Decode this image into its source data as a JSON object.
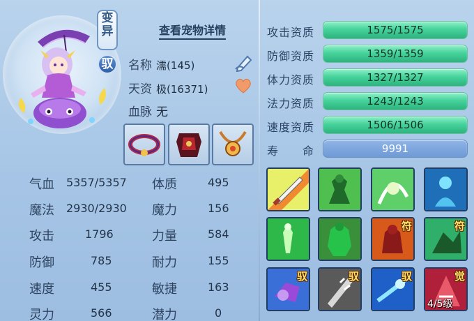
{
  "pet": {
    "badge_transform": "变异",
    "badge_tame": "驭",
    "detail_link": "查看宠物详情",
    "name_label": "名称",
    "name_value": "濡(145)",
    "talent_label": "天资",
    "talent_value": "极(16371)",
    "blood_label": "血脉",
    "blood_value": "无"
  },
  "stats": {
    "hp_label": "气血",
    "hp_value": "5357/5357",
    "mp_label": "魔法",
    "mp_value": "2930/2930",
    "atk_label": "攻击",
    "atk_value": "1796",
    "def_label": "防御",
    "def_value": "785",
    "spd_label": "速度",
    "spd_value": "455",
    "spirit_label": "灵力",
    "spirit_value": "566",
    "con_label": "体质",
    "con_value": "495",
    "mag_label": "魔力",
    "mag_value": "156",
    "str_label": "力量",
    "str_value": "584",
    "end_label": "耐力",
    "end_value": "155",
    "agi_label": "敏捷",
    "agi_value": "163",
    "pot_label": "潜力",
    "pot_value": "0"
  },
  "aptitudes": [
    {
      "label": "攻击资质",
      "value": "1575/1575",
      "fill": 1.0
    },
    {
      "label": "防御资质",
      "value": "1359/1359",
      "fill": 1.0
    },
    {
      "label": "体力资质",
      "value": "1327/1327",
      "fill": 1.0
    },
    {
      "label": "法力资质",
      "value": "1243/1243",
      "fill": 1.0
    },
    {
      "label": "速度资质",
      "value": "1506/1506",
      "fill": 1.0
    },
    {
      "label": "寿　　命",
      "value": "9991"
    }
  ],
  "skills": {
    "tag_fu": "符",
    "tag_yu": "驭",
    "tag_jue": "觉",
    "level": "4/5级"
  },
  "colors": {
    "bar_green": "#3fcf98",
    "bar_blue": "#7aa2da",
    "background": "#a9c7e7"
  }
}
